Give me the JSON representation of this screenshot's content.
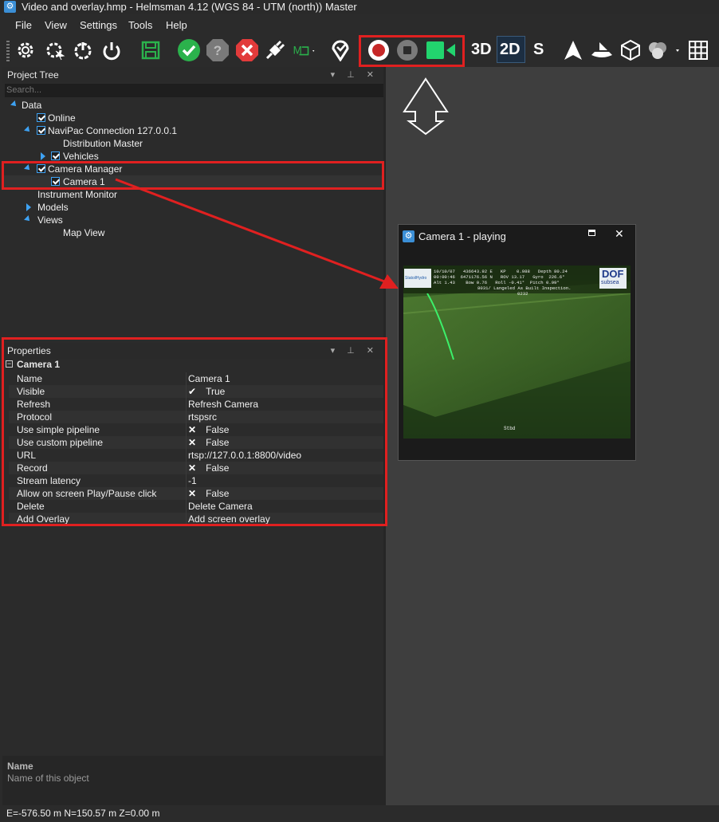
{
  "window": {
    "title": "Video and overlay.hmp - Helmsman 4.12 (WGS 84 - UTM (north)) Master"
  },
  "menu": [
    "File",
    "View",
    "Settings",
    "Tools",
    "Help"
  ],
  "toolbar": {
    "view_3d": "3D",
    "view_2d": "2D",
    "view_s": "S"
  },
  "project_tree": {
    "title": "Project Tree",
    "search_placeholder": "Search...",
    "items": [
      {
        "label": "Data"
      },
      {
        "label": "Online"
      },
      {
        "label": "NaviPac Connection 127.0.0.1"
      },
      {
        "label": "Distribution Master"
      },
      {
        "label": "Vehicles"
      },
      {
        "label": "Camera Manager"
      },
      {
        "label": "Camera 1"
      },
      {
        "label": "Instrument Monitor"
      },
      {
        "label": "Models"
      },
      {
        "label": "Views"
      },
      {
        "label": "Map View"
      }
    ]
  },
  "properties": {
    "title": "Properties",
    "object": "Camera 1",
    "rows": [
      {
        "name": "Name",
        "value": "Camera 1"
      },
      {
        "name": "Visible",
        "value": "True"
      },
      {
        "name": "Refresh",
        "value": "Refresh Camera"
      },
      {
        "name": "Protocol",
        "value": "rtspsrc"
      },
      {
        "name": "Use simple pipeline",
        "value": "False"
      },
      {
        "name": "Use custom pipeline",
        "value": "False"
      },
      {
        "name": "URL",
        "value": "rtsp://127.0.0.1:8800/video"
      },
      {
        "name": "Record",
        "value": "False"
      },
      {
        "name": "Stream latency",
        "value": "-1"
      },
      {
        "name": "Allow on screen Play/Pause click",
        "value": "False"
      },
      {
        "name": "Delete",
        "value": "Delete Camera"
      },
      {
        "name": "Add Overlay",
        "value": "Add screen overlay"
      }
    ]
  },
  "description": {
    "title": "Name",
    "text": "Name of this object"
  },
  "status": {
    "coords": "E=-576.50 m N=150.57 m Z=0.00 m"
  },
  "camera_window": {
    "title": "Camera 1 - playing",
    "overlay": {
      "logo_left": "StatoilHydro",
      "logo_right_1": "DOF",
      "logo_right_2": "subsea",
      "line1": "10/10/07   436643.92 E   KP    0.988   Depth 80.24",
      "line2": "00:00:46  6471176.56 N   ROV 13.17   Gyro  226.6°",
      "line3": "Alt 1.43    Bow 0.76   Roll -0.41°  Pitch 0.99°",
      "line4": "8031/ Langeled As Built Inspection.",
      "line5": "0232",
      "stbd": "Stbd"
    }
  },
  "colors": {
    "accent": "#3ea2f3",
    "highlight": "#e02020",
    "green_ok": "#2bb24c",
    "video_green": "#22d46e"
  }
}
